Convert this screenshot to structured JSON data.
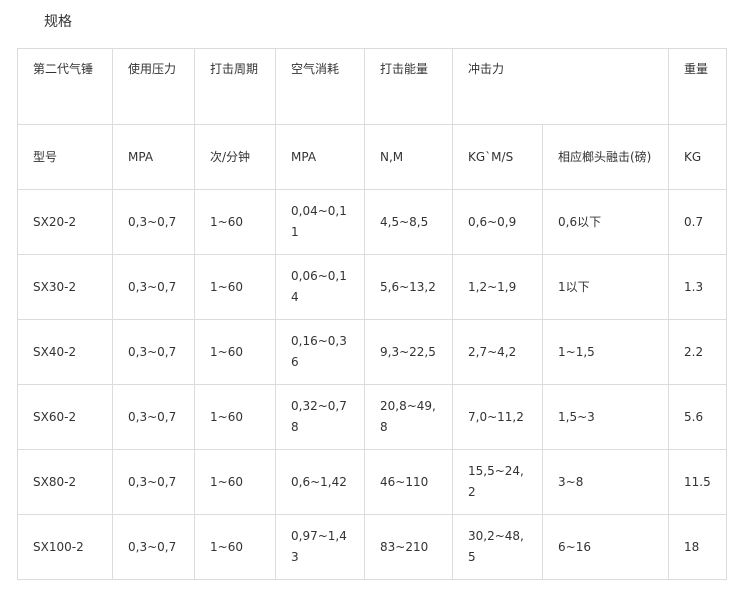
{
  "heading": "规格",
  "header_row1": [
    "第二代气锤",
    "使用压力",
    "打击周期",
    "空气消耗",
    "打击能量",
    "冲击力",
    "重量"
  ],
  "header_row2": [
    "型号",
    "MPA",
    "次/分钟",
    "MPA",
    "N,M",
    "KG`M/S",
    "相应榔头融击(磅)",
    "KG"
  ],
  "rows": [
    [
      "SX20-2",
      "0,3~0,7",
      "1~60",
      "0,04~0,11",
      "4,5~8,5",
      "0,6~0,9",
      "0,6以下",
      "0.7"
    ],
    [
      "SX30-2",
      "0,3~0,7",
      "1~60",
      "0,06~0,14",
      "5,6~13,2",
      "1,2~1,9",
      "1以下",
      "1.3"
    ],
    [
      "SX40-2",
      "0,3~0,7",
      "1~60",
      "0,16~0,36",
      "9,3~22,5",
      "2,7~4,2",
      "1~1,5",
      "2.2"
    ],
    [
      "SX60-2",
      "0,3~0,7",
      "1~60",
      "0,32~0,78",
      "20,8~49,8",
      "7,0~11,2",
      "1,5~3",
      "5.6"
    ],
    [
      "SX80-2",
      "0,3~0,7",
      "1~60",
      "0,6~1,42",
      "46~110",
      "15,5~24,2",
      "3~8",
      "11.5"
    ],
    [
      "SX100-2",
      "0,3~0,7",
      "1~60",
      "0,97~1,43",
      "83~210",
      "30,2~48,5",
      "6~16",
      "18"
    ]
  ]
}
